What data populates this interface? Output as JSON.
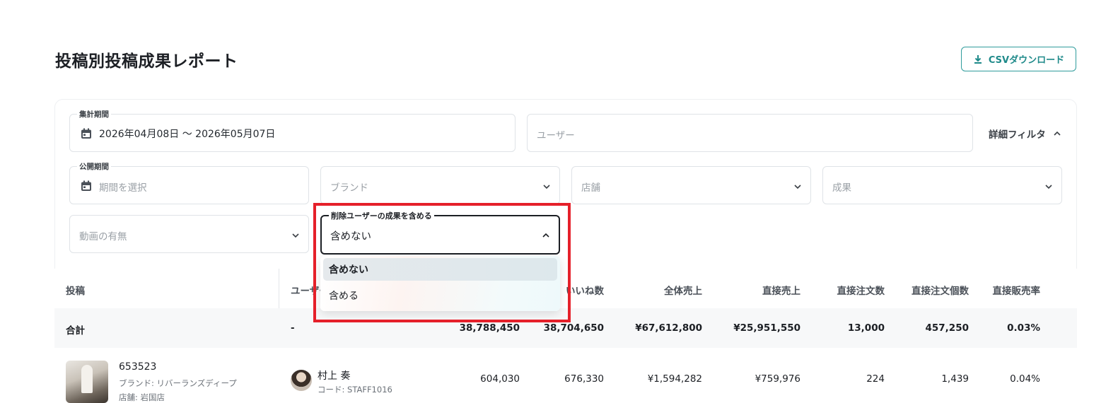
{
  "page": {
    "title": "投稿別投稿成果レポート",
    "csv_button": "CSVダウンロード"
  },
  "filters": {
    "period": {
      "label": "集計期間",
      "value": "2026年04月08日 〜 2026年05月07日"
    },
    "user": {
      "placeholder": "ユーザー"
    },
    "detail_filter": "詳細フィルタ",
    "publish_period": {
      "label": "公開期間",
      "placeholder": "期間を選択"
    },
    "brand": {
      "placeholder": "ブランド"
    },
    "store": {
      "placeholder": "店舗"
    },
    "result": {
      "placeholder": "成果"
    },
    "video": {
      "placeholder": "動画の有無"
    },
    "deleted_users": {
      "label": "削除ユーザーの成果を含める",
      "value": "含めない",
      "options": [
        "含めない",
        "含める"
      ]
    }
  },
  "table": {
    "headers": [
      "投稿",
      "ユーザー",
      "いいね数",
      "全体売上",
      "直接売上",
      "直接注文数",
      "直接注文個数",
      "直接販売率"
    ],
    "total": {
      "label": "合計",
      "user": "-",
      "col_a": "38,788,450",
      "likes": "38,704,650",
      "total_sales": "¥67,612,800",
      "direct_sales": "¥25,951,550",
      "direct_orders": "13,000",
      "direct_items": "457,250",
      "direct_rate": "0.03%"
    },
    "rows": [
      {
        "post_id": "653523",
        "brand": "ブランド: リバーランズディープ",
        "store": "店舗: 岩国店",
        "user_name": "村上 奏",
        "user_code": "コード: STAFF1016",
        "col_a": "604,030",
        "likes": "676,330",
        "total_sales": "¥1,594,282",
        "direct_sales": "¥759,976",
        "direct_orders": "224",
        "direct_items": "1,439",
        "direct_rate": "0.04%"
      }
    ]
  },
  "colors": {
    "accent": "#1f8a8a",
    "highlight": "#e5202a"
  },
  "icons": {
    "download": "download-icon",
    "calendar": "calendar-icon",
    "chevron_down": "chevron-down-icon",
    "chevron_up": "chevron-up-icon"
  }
}
